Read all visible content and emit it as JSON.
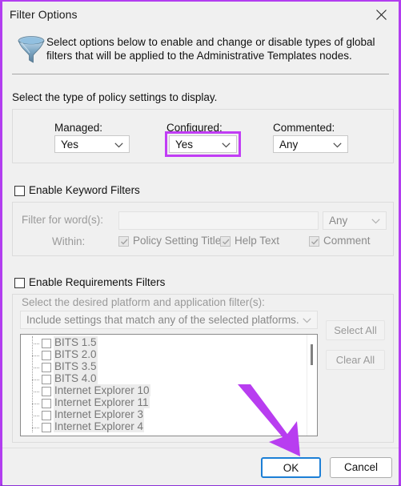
{
  "window": {
    "title": "Filter Options",
    "close_label": "Close",
    "border_color": "#b23df0"
  },
  "header": {
    "icon": "funnel-icon",
    "description": "Select options below to enable and change or disable types of global filters that will be applied to the Administrative Templates nodes."
  },
  "policy_section": {
    "label": "Select the type of policy settings to display.",
    "fields": [
      {
        "label": "Managed:",
        "value": "Yes",
        "highlighted": false
      },
      {
        "label": "Configured:",
        "value": "Yes",
        "highlighted": true
      },
      {
        "label": "Commented:",
        "value": "Any",
        "highlighted": false
      }
    ],
    "highlight_color": "#c13df5"
  },
  "keyword_section": {
    "enable_label": "Enable Keyword Filters",
    "enabled": false,
    "filter_label": "Filter for word(s):",
    "filter_value": "",
    "match_value": "Any",
    "within_label": "Within:",
    "within_options": [
      {
        "label": "Policy Setting Title",
        "checked": true
      },
      {
        "label": "Help Text",
        "checked": true
      },
      {
        "label": "Comment",
        "checked": true
      }
    ]
  },
  "requirements_section": {
    "enable_label": "Enable Requirements Filters",
    "enabled": false,
    "platform_label": "Select the desired platform and application filter(s):",
    "match_mode": "Include settings that match any of the selected platforms.",
    "select_all_label": "Select All",
    "clear_all_label": "Clear All",
    "items": [
      {
        "label": "BITS 1.5",
        "checked": false
      },
      {
        "label": "BITS 2.0",
        "checked": false
      },
      {
        "label": "BITS 3.5",
        "checked": false
      },
      {
        "label": "BITS 4.0",
        "checked": false
      },
      {
        "label": "Internet Explorer 10",
        "checked": false
      },
      {
        "label": "Internet Explorer 11",
        "checked": false
      },
      {
        "label": "Internet Explorer 3",
        "checked": false
      },
      {
        "label": "Internet Explorer 4",
        "checked": false
      }
    ]
  },
  "footer": {
    "ok_label": "OK",
    "cancel_label": "Cancel",
    "ok_is_default": true
  },
  "annotation": {
    "type": "arrow",
    "color": "#b83df0",
    "points_to": "OK"
  }
}
